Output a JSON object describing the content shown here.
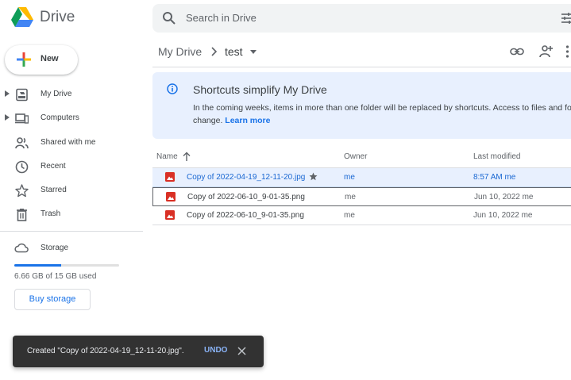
{
  "app": {
    "name": "Drive"
  },
  "search": {
    "placeholder": "Search in Drive"
  },
  "sidebar": {
    "new_label": "New",
    "items": [
      {
        "label": "My Drive",
        "icon": "my-drive-icon",
        "expandable": true
      },
      {
        "label": "Computers",
        "icon": "computers-icon",
        "expandable": true
      },
      {
        "label": "Shared with me",
        "icon": "shared-icon",
        "expandable": false
      },
      {
        "label": "Recent",
        "icon": "clock-icon",
        "expandable": false
      },
      {
        "label": "Starred",
        "icon": "star-icon",
        "expandable": false
      },
      {
        "label": "Trash",
        "icon": "trash-icon",
        "expandable": false
      }
    ],
    "storage": {
      "label": "Storage",
      "used_text": "6.66 GB of 15 GB used",
      "used_fraction": 0.444,
      "buy_label": "Buy storage"
    }
  },
  "breadcrumb": {
    "root": "My Drive",
    "current": "test"
  },
  "banner": {
    "title": "Shortcuts simplify My Drive",
    "body_line1": "In the coming weeks, items in more than one folder will be replaced by shortcuts. Access to files and folders won't",
    "body_line2": "change.",
    "link": "Learn more"
  },
  "table": {
    "columns": {
      "name": "Name",
      "owner": "Owner",
      "modified": "Last modified"
    },
    "rows": [
      {
        "name": "Copy of 2022-04-19_12-11-20.jpg",
        "owner": "me",
        "modified": "8:57 AM me",
        "starred": true,
        "selected": true
      },
      {
        "name": "Copy of 2022-06-10_9-01-35.png",
        "owner": "me",
        "modified": "Jun 10, 2022 me",
        "starred": false,
        "selected": false
      },
      {
        "name": "Copy of 2022-06-10_9-01-35.png",
        "owner": "me",
        "modified": "Jun 10, 2022 me",
        "starred": false,
        "selected": false
      }
    ]
  },
  "toast": {
    "message": "Created \"Copy of 2022-04-19_12-11-20.jpg\".",
    "action": "UNDO"
  },
  "colors": {
    "accent": "#1a73e8",
    "selected_row": "#e8f0fe",
    "file_icon": "#d93025",
    "toast_bg": "#323232"
  }
}
